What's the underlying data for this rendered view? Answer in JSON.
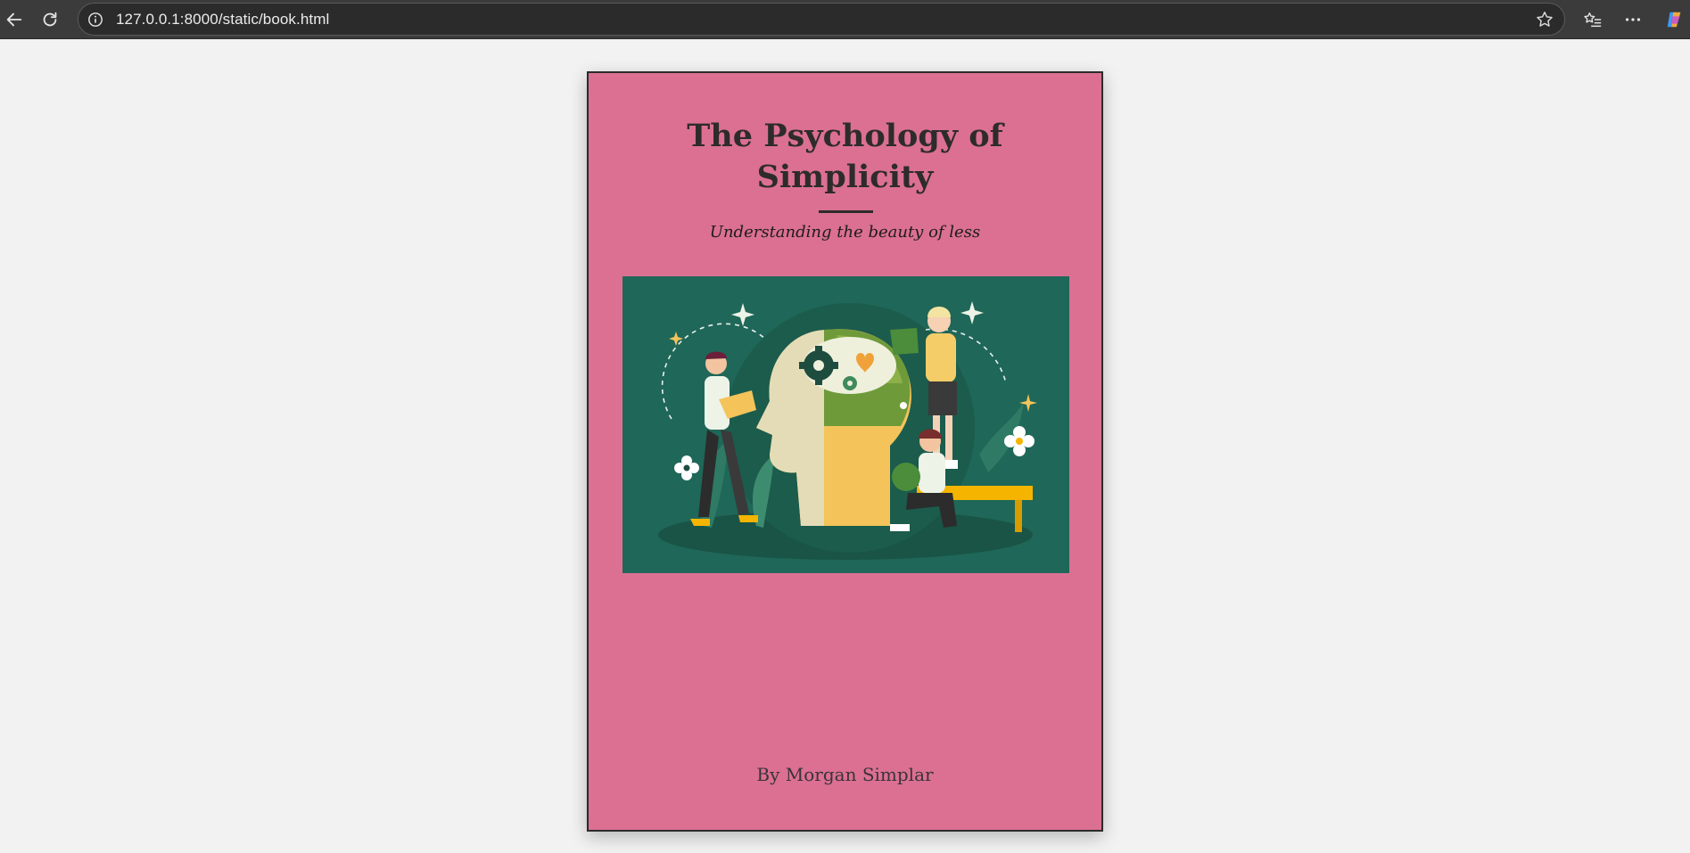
{
  "browser": {
    "url": "127.0.0.1:8000/static/book.html"
  },
  "book": {
    "title_line1": "The Psychology of",
    "title_line2": "Simplicity",
    "subtitle": "Understanding the beauty of less",
    "author": "By Morgan Simplar",
    "cover_color": "#db7093",
    "illustration_bg": "#1f6758"
  }
}
